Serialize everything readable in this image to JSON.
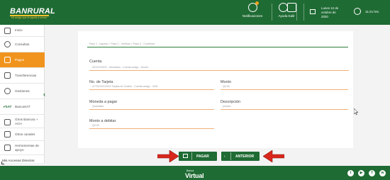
{
  "header": {
    "logo_text": "BANRURAL",
    "logo_tagline": "Mi amigo que te ayuda a crecer",
    "notifications_label": "Notificaciones",
    "help_label": "Ayuda",
    "exit_label": "Salir",
    "date": "Lunes 12 de octubre de 2020",
    "time": "11:21 hrs."
  },
  "sidebar": {
    "items": [
      {
        "label": "Inicio",
        "icon": "home-icon"
      },
      {
        "label": "Consultas",
        "icon": "search-icon"
      },
      {
        "label": "Pagos",
        "icon": "payments-icon",
        "active": true
      },
      {
        "label": "Transferencias",
        "icon": "transfer-icon"
      },
      {
        "label": "Gestiones",
        "icon": "gear-icon"
      },
      {
        "label": "BancaSAT",
        "icon": "bancasat-icon"
      },
      {
        "label": "Giros Banrura + ACH",
        "icon": "bank-icon"
      },
      {
        "label": "Otros canales",
        "icon": "grid-icon"
      },
      {
        "label": "Herramientas de apoyo",
        "icon": "tools-icon"
      }
    ],
    "accesos_label": "Mis Accesos Directos"
  },
  "form": {
    "breadcrumb": "Paso 1 - Ingreso   >   Paso 2 - Verificar   >   Paso 3 - Confirmar",
    "cuenta_label": "Cuenta",
    "cuenta_value": "3XXXXXX0X - Monetario - Cuenta amigo - Ahorro",
    "tarjeta_label": "No. de Tarjeta",
    "tarjeta_value": "4770XXXXXX0X Tarjeta de Crédito - Cuenta amigo - USD",
    "monto_label": "Monto",
    "monto_value": "Q0.00",
    "moneda_label": "Moneda a pagar",
    "moneda_value": "Quetzales",
    "descripcion_label": "Descripción",
    "descripcion_value": "prueba",
    "debitar_label": "Monto a debitar",
    "debitar_value": "Q0.00"
  },
  "buttons": {
    "pagar_label": "PAGAR",
    "anterior_label": "ANTERIOR"
  },
  "footer": {
    "small_text": "Banca",
    "brand": "Virtual",
    "social": [
      "twitter-icon",
      "youtube-icon",
      "facebook-icon",
      "whatsapp-icon"
    ]
  },
  "colors": {
    "brand_green": "#1f6b34",
    "accent_orange": "#f0941e",
    "arrow_red": "#d9261c"
  }
}
